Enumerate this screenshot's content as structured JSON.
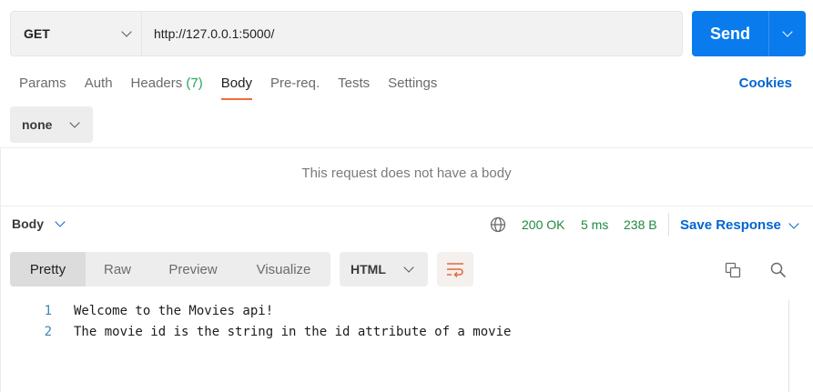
{
  "request": {
    "method": "GET",
    "url": "http://127.0.0.1:5000/",
    "send_label": "Send"
  },
  "tabs": [
    {
      "label": "Params"
    },
    {
      "label": "Auth"
    },
    {
      "label": "Headers",
      "count": "(7)"
    },
    {
      "label": "Body",
      "active": true
    },
    {
      "label": "Pre-req."
    },
    {
      "label": "Tests"
    },
    {
      "label": "Settings"
    }
  ],
  "cookies_label": "Cookies",
  "body_mode": "none",
  "no_body_message": "This request does not have a body",
  "response": {
    "label": "Body",
    "status": "200 OK",
    "time": "5 ms",
    "size": "238 B",
    "save_label": "Save Response",
    "views": [
      "Pretty",
      "Raw",
      "Preview",
      "Visualize"
    ],
    "active_view": "Pretty",
    "language": "HTML",
    "lines": [
      {
        "n": "1",
        "text": "Welcome to the Movies api!"
      },
      {
        "n": "2",
        "text": "The movie id is the string in the id attribute of a movie"
      }
    ]
  },
  "colors": {
    "accent": "#097bed",
    "link": "#0265d2",
    "tab_underline": "#f26b3a",
    "status_ok": "#1f8a3d",
    "wrap_icon": "#e8643a"
  },
  "icons": {
    "method_dropdown": "chevron-down-icon",
    "send_dropdown": "chevron-down-icon",
    "network": "globe-icon",
    "wrap": "wrap-lines-icon",
    "copy": "copy-icon",
    "search": "search-icon"
  }
}
